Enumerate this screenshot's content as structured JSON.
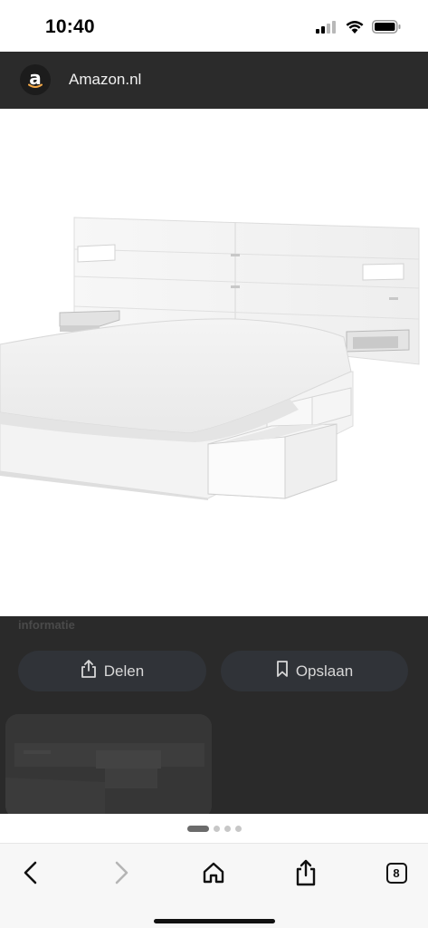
{
  "status": {
    "time": "10:40"
  },
  "site": {
    "name": "Amazon.nl",
    "logo_letter": "a",
    "logo_icon": "amazon-logo-icon"
  },
  "sheet": {
    "section_label": "informatie",
    "share_label": "Delen",
    "save_label": "Opslaan"
  },
  "pager": {
    "total": 4,
    "active": 1
  },
  "toolbar": {
    "tab_count": "8"
  },
  "colors": {
    "header_bg": "#2b2b2b",
    "sheet_bg": "#2a2a2a",
    "pill_bg": "#303338",
    "logo_smile": "#f3a847"
  }
}
